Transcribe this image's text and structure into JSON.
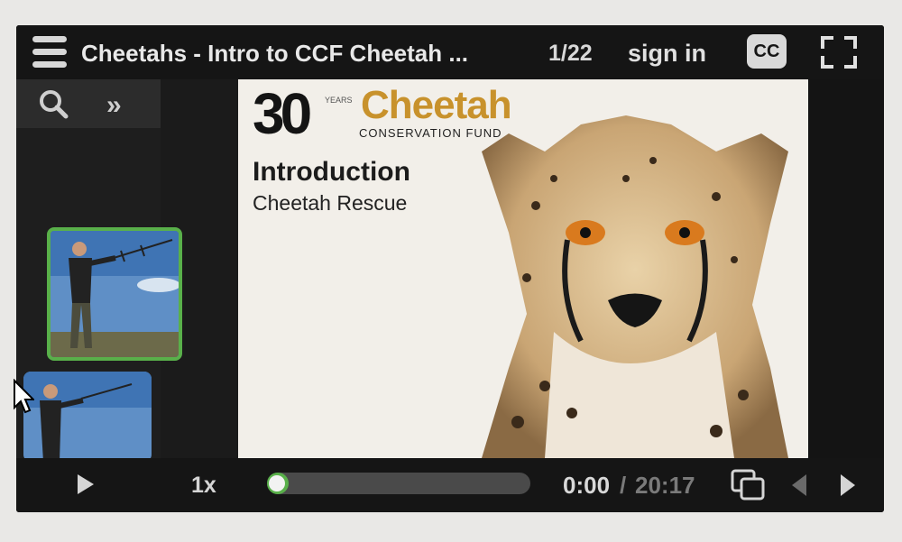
{
  "header": {
    "title": "Cheetahs - Intro to CCF Cheetah ...",
    "slide_counter": "1/22",
    "sign_in_label": "sign in",
    "cc_label": "CC",
    "menu_icon": "hamburger-icon",
    "fullscreen_icon": "fullscreen-icon"
  },
  "sidebar": {
    "search_icon": "search-icon",
    "expand_label": "»",
    "thumbnails": [
      {
        "name": "slide-thumb-1",
        "active": true
      },
      {
        "name": "slide-thumb-2",
        "active": false
      }
    ]
  },
  "slide": {
    "logo_number": "30",
    "logo_years": "YEARS",
    "logo_name": "Cheetah",
    "logo_sub": "CONSERVATION FUND",
    "heading": "Introduction",
    "subheading": "Cheetah Rescue"
  },
  "controls": {
    "speed": "1x",
    "progress_fraction": 0.03,
    "time_current": "0:00",
    "time_separator": "/",
    "time_total": "20:17"
  },
  "colors": {
    "accent": "#59b04a",
    "logo_gold": "#c8922c",
    "bar_bg": "#151515"
  }
}
